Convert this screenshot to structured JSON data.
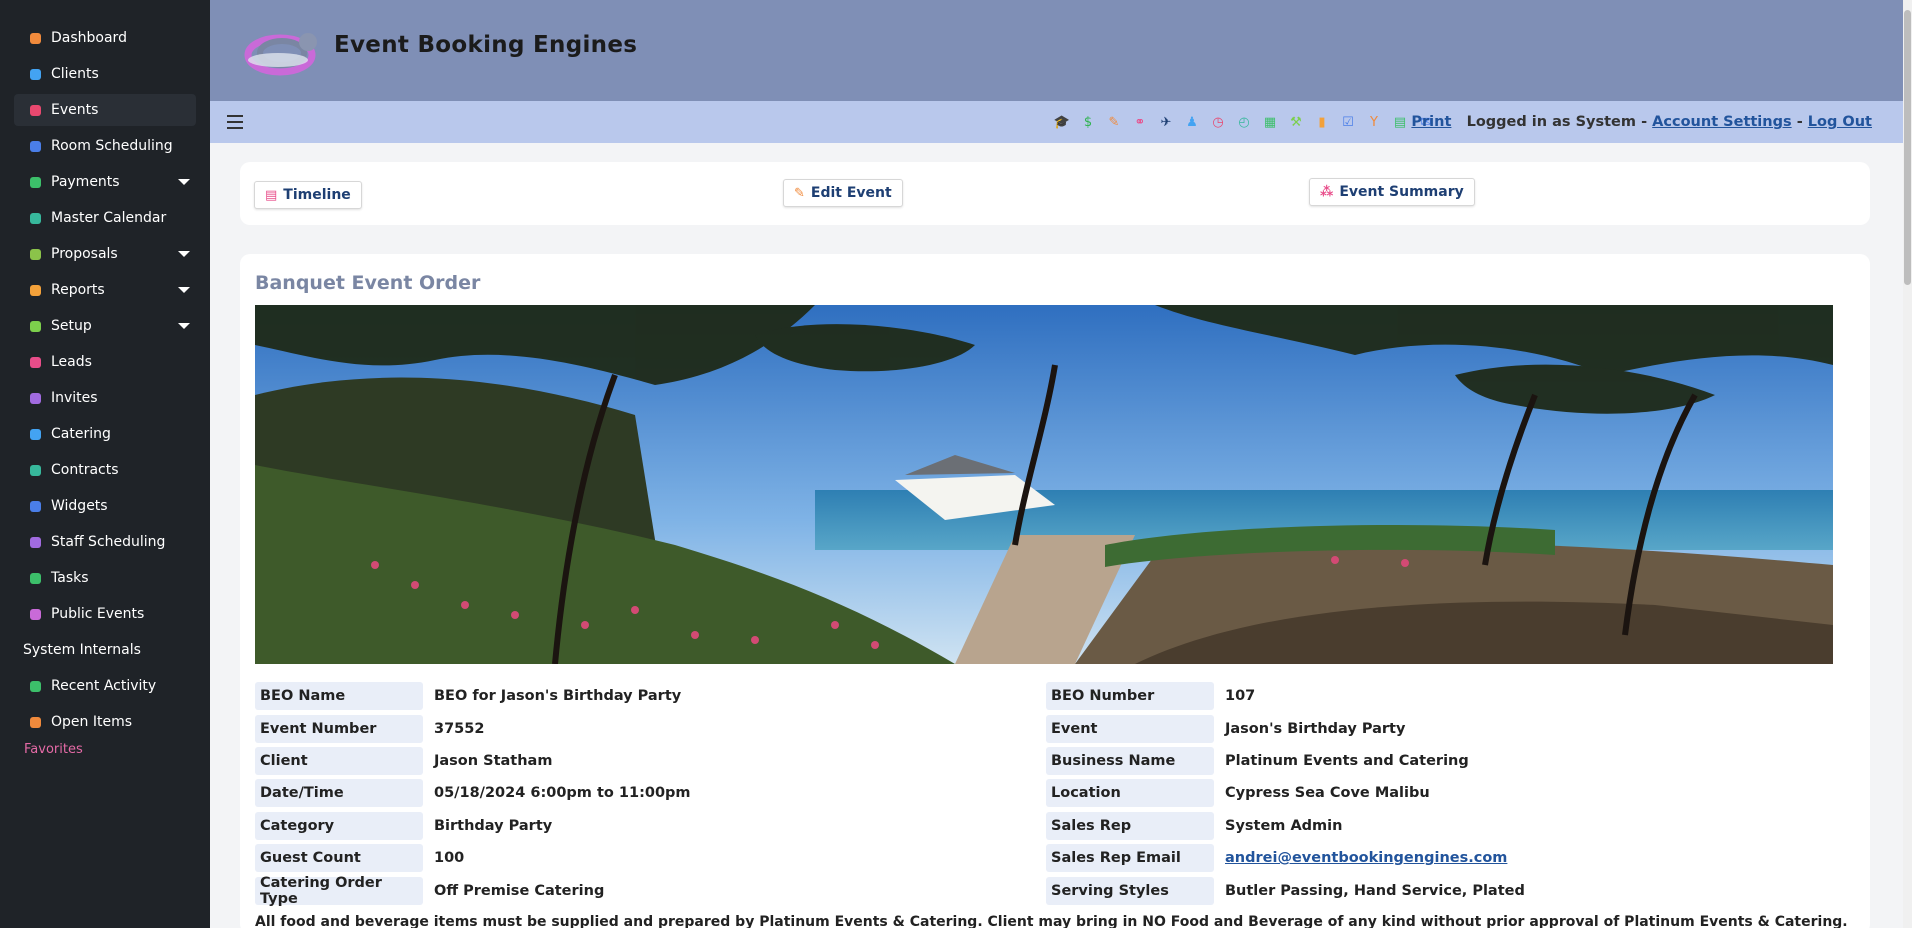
{
  "brand": {
    "name": "Event Booking Engines"
  },
  "sidebar": {
    "items": [
      {
        "label": "Dashboard",
        "icon": "dashboard-icon",
        "color": "#f08a3c"
      },
      {
        "label": "Clients",
        "icon": "person-icon",
        "color": "#43a3f2"
      },
      {
        "label": "Events",
        "icon": "cocktail-icon",
        "color": "#e8486f",
        "active": true
      },
      {
        "label": "Room Scheduling",
        "icon": "group-icon",
        "color": "#4a7ee8"
      },
      {
        "label": "Payments",
        "icon": "money-icon",
        "color": "#3cbf6a",
        "caret": true
      },
      {
        "label": "Master Calendar",
        "icon": "calendar-icon",
        "color": "#37b89c"
      },
      {
        "label": "Proposals",
        "icon": "proposal-icon",
        "color": "#8bc34a",
        "caret": true
      },
      {
        "label": "Reports",
        "icon": "bar-chart-icon",
        "color": "#f3a13a",
        "caret": true
      },
      {
        "label": "Setup",
        "icon": "wrench-icon",
        "color": "#7ccf4c",
        "caret": true
      },
      {
        "label": "Leads",
        "icon": "leads-icon",
        "color": "#e84d8a"
      },
      {
        "label": "Invites",
        "icon": "invite-icon",
        "color": "#a16be0"
      },
      {
        "label": "Catering",
        "icon": "utensils-icon",
        "color": "#43a3f2"
      },
      {
        "label": "Contracts",
        "icon": "contract-icon",
        "color": "#37b89c"
      },
      {
        "label": "Widgets",
        "icon": "widget-icon",
        "color": "#4a7ee8"
      },
      {
        "label": "Staff Scheduling",
        "icon": "staff-icon",
        "color": "#a16be0"
      },
      {
        "label": "Tasks",
        "icon": "checkbox-icon",
        "color": "#3cbf6a"
      },
      {
        "label": "Public Events",
        "icon": "tag-icon",
        "color": "#c96ad8"
      }
    ],
    "section": "System Internals",
    "extra": [
      {
        "label": "Recent Activity",
        "icon": "dollar-icon",
        "color": "#3cbf6a"
      },
      {
        "label": "Open Items",
        "icon": "edit-icon",
        "color": "#f08a3c"
      }
    ],
    "favorites": "Favorites"
  },
  "toolbar": {
    "icons": [
      {
        "name": "graduation-cap-icon",
        "glyph": "🎓",
        "color": "#1e5aa8"
      },
      {
        "name": "dollar-icon",
        "glyph": "$",
        "color": "#2eb34f"
      },
      {
        "name": "edit-icon",
        "glyph": "✎",
        "color": "#f08a3c"
      },
      {
        "name": "link-icon",
        "glyph": "⚭",
        "color": "#e84d8a"
      },
      {
        "name": "plane-icon",
        "glyph": "✈",
        "color": "#1e3f73"
      },
      {
        "name": "person-icon",
        "glyph": "♟",
        "color": "#43a3f2"
      },
      {
        "name": "clock-icon",
        "glyph": "◷",
        "color": "#e8486f"
      },
      {
        "name": "clock-outline-icon",
        "glyph": "◴",
        "color": "#37b89c"
      },
      {
        "name": "calculator-icon",
        "glyph": "▦",
        "color": "#3cbf6a"
      },
      {
        "name": "tools-icon",
        "glyph": "⚒",
        "color": "#7ccf4c"
      },
      {
        "name": "signal-icon",
        "glyph": "▮",
        "color": "#f3a13a"
      },
      {
        "name": "checkbox-icon",
        "glyph": "☑",
        "color": "#4a7ee8"
      },
      {
        "name": "cocktail-icon",
        "glyph": "Y",
        "color": "#f08a3c"
      },
      {
        "name": "book-icon",
        "glyph": "▤",
        "color": "#3cbf6a"
      },
      {
        "name": "envelope-icon",
        "glyph": "✉",
        "color": "#4a7ee8"
      }
    ],
    "print": "Print",
    "logged_in": "Logged in as System",
    "sep": "-",
    "account_settings": "Account Settings",
    "log_out": "Log Out"
  },
  "tabs": {
    "timeline": "Timeline",
    "edit_event": "Edit Event",
    "event_summary": "Event Summary"
  },
  "beo": {
    "title": "Banquet Event Order",
    "left": [
      {
        "key": "BEO Name",
        "value": "BEO for Jason's Birthday Party"
      },
      {
        "key": "Event Number",
        "value": "37552"
      },
      {
        "key": "Client",
        "value": "Jason Statham"
      },
      {
        "key": "Date/Time",
        "value": "05/18/2024 6:00pm to 11:00pm"
      },
      {
        "key": "Category",
        "value": "Birthday Party"
      },
      {
        "key": "Guest Count",
        "value": "100"
      },
      {
        "key": "Catering Order Type",
        "value": "Off Premise Catering"
      }
    ],
    "right": [
      {
        "key": "BEO Number",
        "value": "107"
      },
      {
        "key": "Event",
        "value": "Jason's Birthday Party"
      },
      {
        "key": "Business Name",
        "value": "Platinum Events and Catering"
      },
      {
        "key": "Location",
        "value": "Cypress Sea Cove Malibu"
      },
      {
        "key": "Sales Rep",
        "value": "System Admin"
      },
      {
        "key": "Sales Rep Email",
        "value": "andrei@eventbookingengines.com",
        "link": true
      },
      {
        "key": "Serving Styles",
        "value": "Butler Passing, Hand Service, Plated"
      }
    ],
    "disclaimer": "All food and beverage items must be supplied and prepared by Platinum Events & Catering. Client may bring in NO Food and Beverage of any kind without prior approval of Platinum Events & Catering."
  }
}
